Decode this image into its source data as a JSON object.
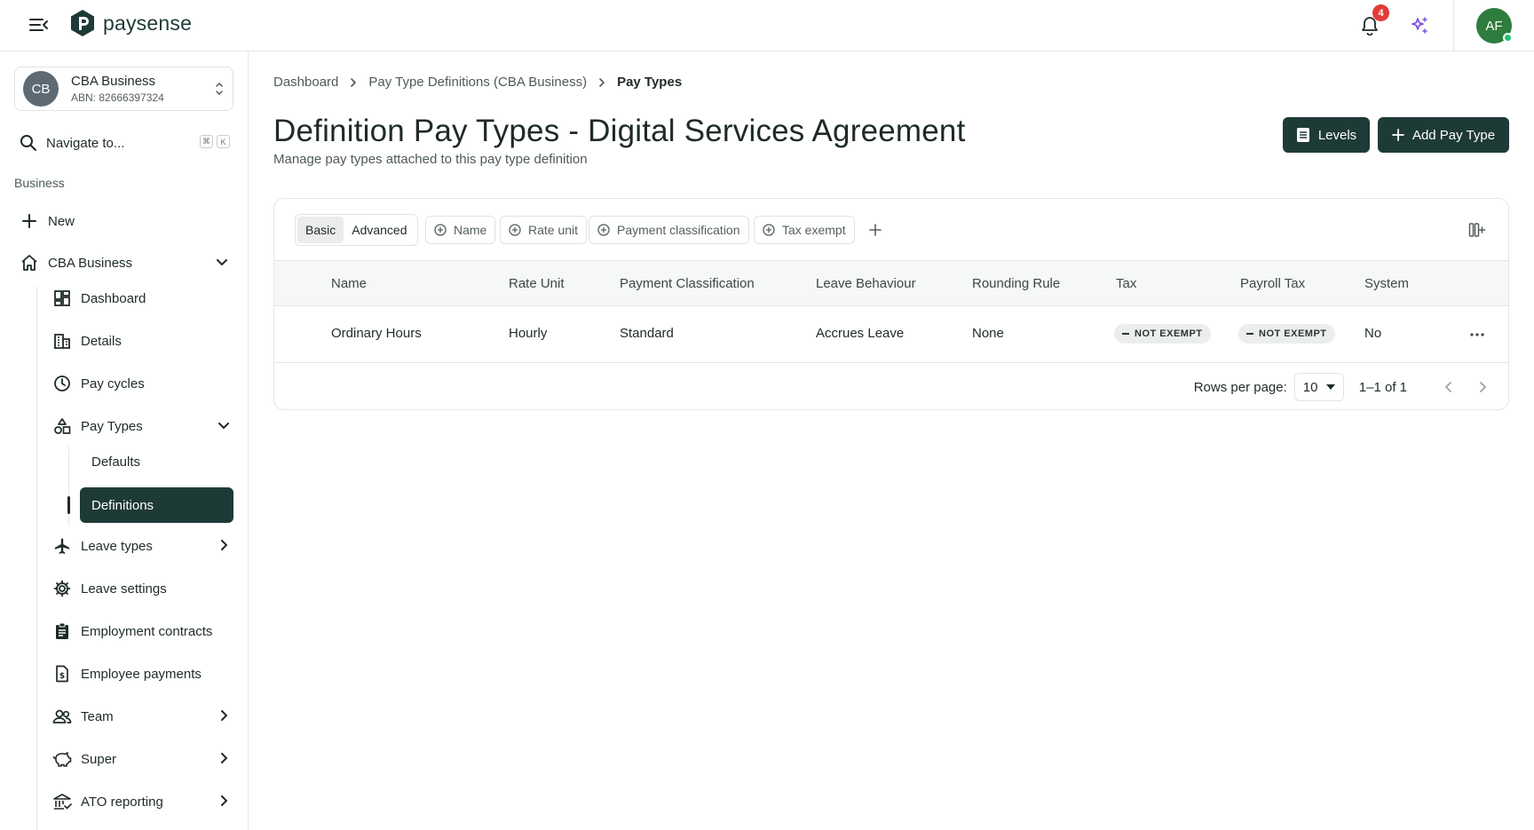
{
  "app": {
    "brand": "paysense",
    "notifications_count": "4",
    "user_initials": "AF"
  },
  "sidebar": {
    "business": {
      "initials": "CB",
      "name": "CBA Business",
      "abn": "ABN: 82666397324"
    },
    "navigate_label": "Navigate to...",
    "shortcut_keys": [
      "⌘",
      "K"
    ],
    "section_label": "Business",
    "new_label": "New",
    "business_group_label": "CBA Business",
    "items": [
      {
        "label": "Dashboard",
        "icon": "dashboard-icon"
      },
      {
        "label": "Details",
        "icon": "building-icon"
      },
      {
        "label": "Pay cycles",
        "icon": "clock-icon"
      },
      {
        "label": "Pay Types",
        "icon": "shapes-icon"
      },
      {
        "label": "Leave types",
        "icon": "plane-icon"
      },
      {
        "label": "Leave settings",
        "icon": "gear-icon"
      },
      {
        "label": "Employment contracts",
        "icon": "clipboard-icon"
      },
      {
        "label": "Employee payments",
        "icon": "payment-doc-icon"
      },
      {
        "label": "Team",
        "icon": "people-icon"
      },
      {
        "label": "Super",
        "icon": "piggy-bank-icon"
      },
      {
        "label": "ATO reporting",
        "icon": "bank-icon"
      }
    ],
    "pay_types_children": [
      "Defaults",
      "Definitions"
    ]
  },
  "breadcrumb": [
    "Dashboard",
    "Pay Type Definitions (CBA Business)",
    "Pay Types"
  ],
  "page": {
    "title": "Definition Pay Types - Digital Services Agreement",
    "subtitle": "Manage pay types attached to this pay type definition",
    "levels_button": "Levels",
    "add_button": "Add Pay Type"
  },
  "filters": {
    "modes": [
      "Basic",
      "Advanced"
    ],
    "chips": [
      "Name",
      "Rate unit",
      "Payment classification",
      "Tax exempt"
    ]
  },
  "table": {
    "columns": [
      "Name",
      "Rate Unit",
      "Payment Classification",
      "Leave Behaviour",
      "Rounding Rule",
      "Tax",
      "Payroll Tax",
      "System"
    ],
    "rows": [
      {
        "name": "Ordinary Hours",
        "rate_unit": "Hourly",
        "payment_classification": "Standard",
        "leave_behaviour": "Accrues Leave",
        "rounding_rule": "None",
        "tax": "NOT EXEMPT",
        "payroll_tax": "NOT EXEMPT",
        "system": "No"
      }
    ]
  },
  "pagination": {
    "rows_per_page_label": "Rows per page:",
    "rows_per_page_value": "10",
    "range": "1–1 of 1"
  },
  "colors": {
    "brand_dark": "#1e3a37",
    "badge_red": "#e23b3b",
    "avatar_green": "#2f7d3e",
    "sparkle_purple": "#7b4fe0"
  }
}
